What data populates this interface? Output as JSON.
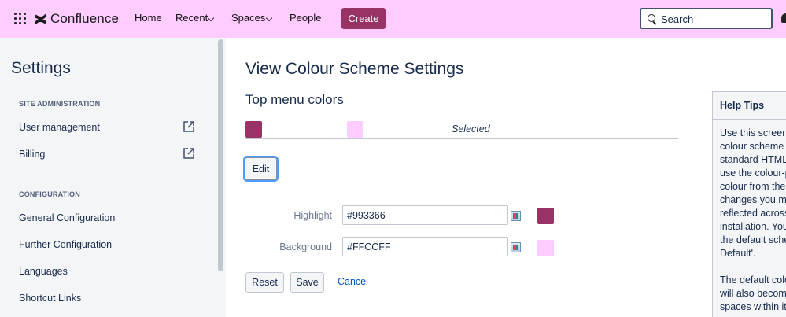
{
  "app": {
    "name": "Confluence"
  },
  "colors": {
    "nav_background": "#ffccff",
    "accent": "#993366",
    "sidebar_background": "#f4f5f7",
    "link": "#0052cc"
  },
  "topnav": {
    "apps_icon": "app-switcher-grid-icon",
    "logo_icon": "confluence-logo-icon",
    "items": [
      {
        "label": "Home",
        "has_dropdown": false
      },
      {
        "label": "Recent",
        "has_dropdown": true
      },
      {
        "label": "Spaces",
        "has_dropdown": true
      },
      {
        "label": "People",
        "has_dropdown": false
      }
    ],
    "create_label": "Create",
    "search_placeholder": "Search",
    "notification_icon": "bell-icon"
  },
  "sidebar": {
    "title": "Settings",
    "sections": [
      {
        "heading": "SITE ADMINISTRATION",
        "items": [
          {
            "label": "User management",
            "external": true
          },
          {
            "label": "Billing",
            "external": true
          }
        ]
      },
      {
        "heading": "CONFIGURATION",
        "items": [
          {
            "label": "General Configuration"
          },
          {
            "label": "Further Configuration"
          },
          {
            "label": "Languages"
          },
          {
            "label": "Shortcut Links"
          }
        ]
      }
    ]
  },
  "main": {
    "title": "View Colour Scheme Settings",
    "subtitle": "Top menu colors",
    "preview": {
      "highlight_swatch": "#993366",
      "background_swatch": "#FFCCFF",
      "selected_label": "Selected"
    },
    "edit_label": "Edit",
    "fields": [
      {
        "label": "Highlight",
        "value": "#993366",
        "swatch": "#993366"
      },
      {
        "label": "Background",
        "value": "#FFCCFF",
        "swatch": "#FFCCFF"
      }
    ],
    "reset_label": "Reset",
    "save_label": "Save",
    "cancel_label": "Cancel"
  },
  "help": {
    "title": "Help Tips",
    "lines": [
      "Use this screen t",
      "colour scheme o",
      "standard HTML/",
      "use the colour-p",
      "colour from the p",
      "changes you ma",
      "reflected across",
      "installation. You c",
      "the default schem",
      "Default'.",
      "",
      "The default colo",
      "will also become",
      "spaces within it."
    ]
  }
}
